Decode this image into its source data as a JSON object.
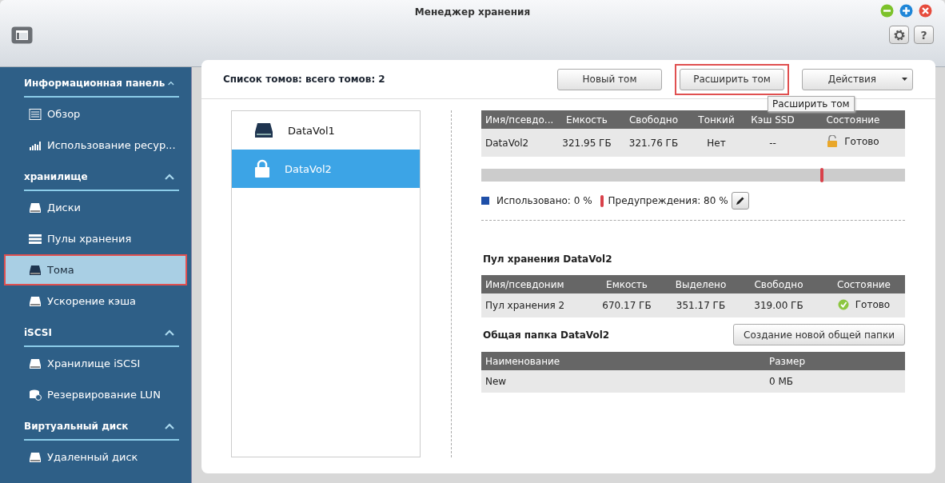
{
  "window": {
    "title": "Менеджер хранения",
    "controls": [
      {
        "kind": "minimize"
      },
      {
        "kind": "maximize"
      },
      {
        "kind": "close"
      }
    ],
    "toolbar": [
      {
        "kind": "settings"
      },
      {
        "kind": "help",
        "label": "?"
      }
    ]
  },
  "sidebar": {
    "sections": [
      {
        "title": "Информационная панель",
        "expanded": true,
        "items": [
          {
            "label": "Обзор",
            "kind": "list",
            "selected": false,
            "highlighted": false
          },
          {
            "label": "Использование ресур...",
            "kind": "chart",
            "selected": false,
            "highlighted": false
          }
        ]
      },
      {
        "title": "хранилище",
        "expanded": true,
        "items": [
          {
            "label": "Диски",
            "kind": "disk",
            "selected": false,
            "highlighted": false
          },
          {
            "label": "Пулы хранения",
            "kind": "stack",
            "selected": false,
            "highlighted": false
          },
          {
            "label": "Тома",
            "kind": "volume",
            "selected": true,
            "highlighted": true
          },
          {
            "label": "Ускорение кэша",
            "kind": "cache",
            "selected": false,
            "highlighted": false
          }
        ]
      },
      {
        "title": "iSCSI",
        "expanded": true,
        "items": [
          {
            "label": "Хранилище iSCSI",
            "kind": "drive",
            "selected": false,
            "highlighted": false
          },
          {
            "label": "Резервирование LUN",
            "kind": "backup",
            "selected": false,
            "highlighted": false
          }
        ]
      },
      {
        "title": "Виртуальный диск",
        "expanded": true,
        "items": [
          {
            "label": "Удаленный диск",
            "kind": "remote",
            "selected": false,
            "highlighted": false
          }
        ]
      }
    ]
  },
  "header": {
    "title": "Список томов: всего томов: 2",
    "buttons": [
      {
        "label": "Новый том",
        "kind": "plain",
        "highlighted": false
      },
      {
        "label": "Расширить том",
        "kind": "plain",
        "highlighted": true
      },
      {
        "label": "Действия",
        "kind": "dropdown",
        "highlighted": false
      }
    ],
    "tooltip": "Расширить том"
  },
  "volumes": [
    {
      "name": "DataVol1",
      "kind": "disk",
      "selected": false
    },
    {
      "name": "DataVol2",
      "kind": "locked",
      "selected": true
    }
  ],
  "volume_table": {
    "columns": [
      "Имя/псевдо...",
      "Емкость",
      "Свободно",
      "Тонкий",
      "Кэш SSD",
      "Состояние"
    ],
    "rows": [
      {
        "cells": [
          "DataVol2",
          "321.95 ГБ",
          "321.76 ГБ",
          "Нет",
          "--"
        ],
        "status": "Готово",
        "kind": "unlocked"
      }
    ]
  },
  "usage": {
    "used": {
      "label": "Использовано: 0 %",
      "level": 0
    },
    "warning": {
      "label": "Предупреждения: 80 %",
      "level": 0.8
    }
  },
  "pool": {
    "title": "Пул хранения DataVol2",
    "columns": [
      "Имя/псевдоним",
      "Емкость",
      "Выделено",
      "Свободно",
      "Состояние"
    ],
    "rows": [
      {
        "cells": [
          "Пул хранения 2",
          "670.17 ГБ",
          "351.17 ГБ",
          "319.00 ГБ"
        ],
        "status": "Готово",
        "kind": "ok"
      }
    ]
  },
  "shared": {
    "title": "Общая папка DataVol2",
    "button": "Создание новой общей папки",
    "columns": [
      "Наименование",
      "Размер"
    ],
    "rows": [
      {
        "cells": [
          "New",
          "0 МБ"
        ]
      }
    ]
  }
}
